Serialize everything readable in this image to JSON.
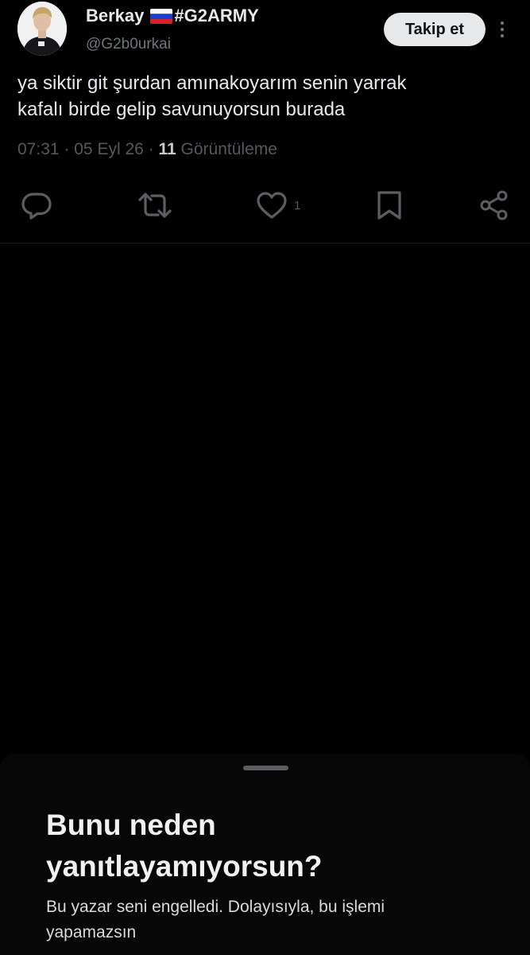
{
  "tweet": {
    "author": {
      "name": "Berkay",
      "flag": "russia-flag",
      "hashtag": "#G2ARMY",
      "handle": "@G2b0urkai"
    },
    "follow_label": "Takip et",
    "text_lines": [
      "ya siktir git şurdan amınakoyarım senin yarrak",
      "kafalı birde gelip savunuyorsun burada"
    ],
    "time": "07:31",
    "date": "05 Eyl 26",
    "separator": "·",
    "views_count": "11",
    "views_label": "Görüntüleme",
    "actions": {
      "reply": "reply-icon",
      "retweet": "retweet-icon",
      "like": "heart-icon",
      "like_count": "1",
      "bookmark": "bookmark-icon",
      "share": "share-icon"
    }
  },
  "sheet": {
    "title_lines": [
      "Bunu neden",
      "yanıtlayamıyorsun?"
    ],
    "body_lines": [
      "Bu yazar seni engelledi. Dolayısıyla, bu işlemi",
      "yapamazsın"
    ]
  },
  "colors": {
    "background": "#000000",
    "sheet_background": "#070707",
    "text_primary": "#e7e9ea",
    "text_secondary": "#71767b",
    "follow_button_bg": "#e6e8ea",
    "icon_color": "#5b5f64"
  }
}
